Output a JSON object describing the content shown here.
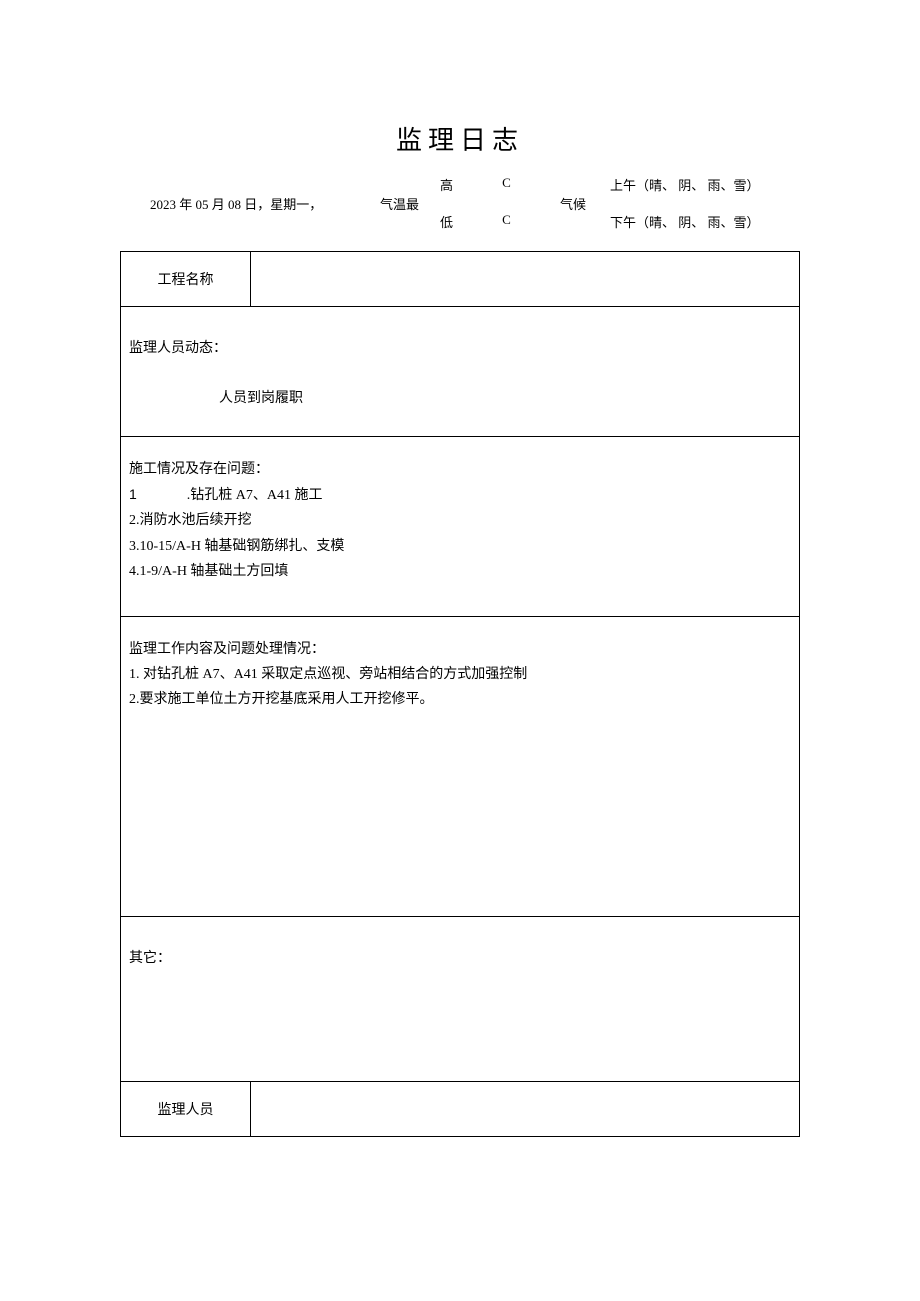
{
  "title": "监理日志",
  "header": {
    "date": "2023 年 05 月 08 日，星期一，",
    "temp_label": "气温最",
    "temp_high_label": "高",
    "temp_high_unit": "C",
    "temp_low_label": "低",
    "temp_low_unit": "C",
    "climate_label": "气候",
    "climate_am": "上午（晴、 阴、 雨、雪）",
    "climate_pm": "下午（晴、 阴、 雨、雪）"
  },
  "sections": {
    "project_label": "工程名称",
    "personnel_title": "监理人员动态：",
    "personnel_body": "人员到岗履职",
    "construction_title": "施工情况及存在问题：",
    "construction_items": {
      "i1_num": "1",
      "i1_text": ".钻孔桩 A7、A41 施工",
      "i2": "2.消防水池后续开挖",
      "i3": "3.10-15/A-H 轴基础钢筋绑扎、支模",
      "i4": "4.1-9/A-H 轴基础土方回填"
    },
    "supervision_title": "监理工作内容及问题处理情况：",
    "supervision_items": {
      "i1": "1. 对钻孔桩 A7、A41 采取定点巡视、旁站相结合的方式加强控制",
      "i2": "2.要求施工单位土方开挖基底采用人工开挖修平。"
    },
    "other_title": "其它：",
    "signer_label": "监理人员"
  }
}
